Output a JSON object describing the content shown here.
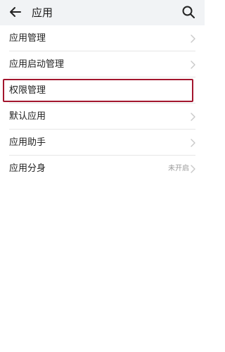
{
  "header": {
    "title": "应用",
    "back_icon": "back-arrow-icon",
    "search_icon": "search-icon"
  },
  "rows": [
    {
      "label": "应用管理",
      "value": "",
      "chevron": true
    },
    {
      "label": "应用启动管理",
      "value": "",
      "chevron": true
    },
    {
      "label": "权限管理",
      "value": "",
      "chevron": false,
      "highlighted": true
    },
    {
      "label": "默认应用",
      "value": "",
      "chevron": true
    },
    {
      "label": "应用助手",
      "value": "",
      "chevron": true
    },
    {
      "label": "应用分身",
      "value": "未开启",
      "chevron": true
    }
  ],
  "colors": {
    "header_bg": "#f1f3f5",
    "highlight_border": "#a3162e",
    "chevron": "#c8c8c8"
  }
}
